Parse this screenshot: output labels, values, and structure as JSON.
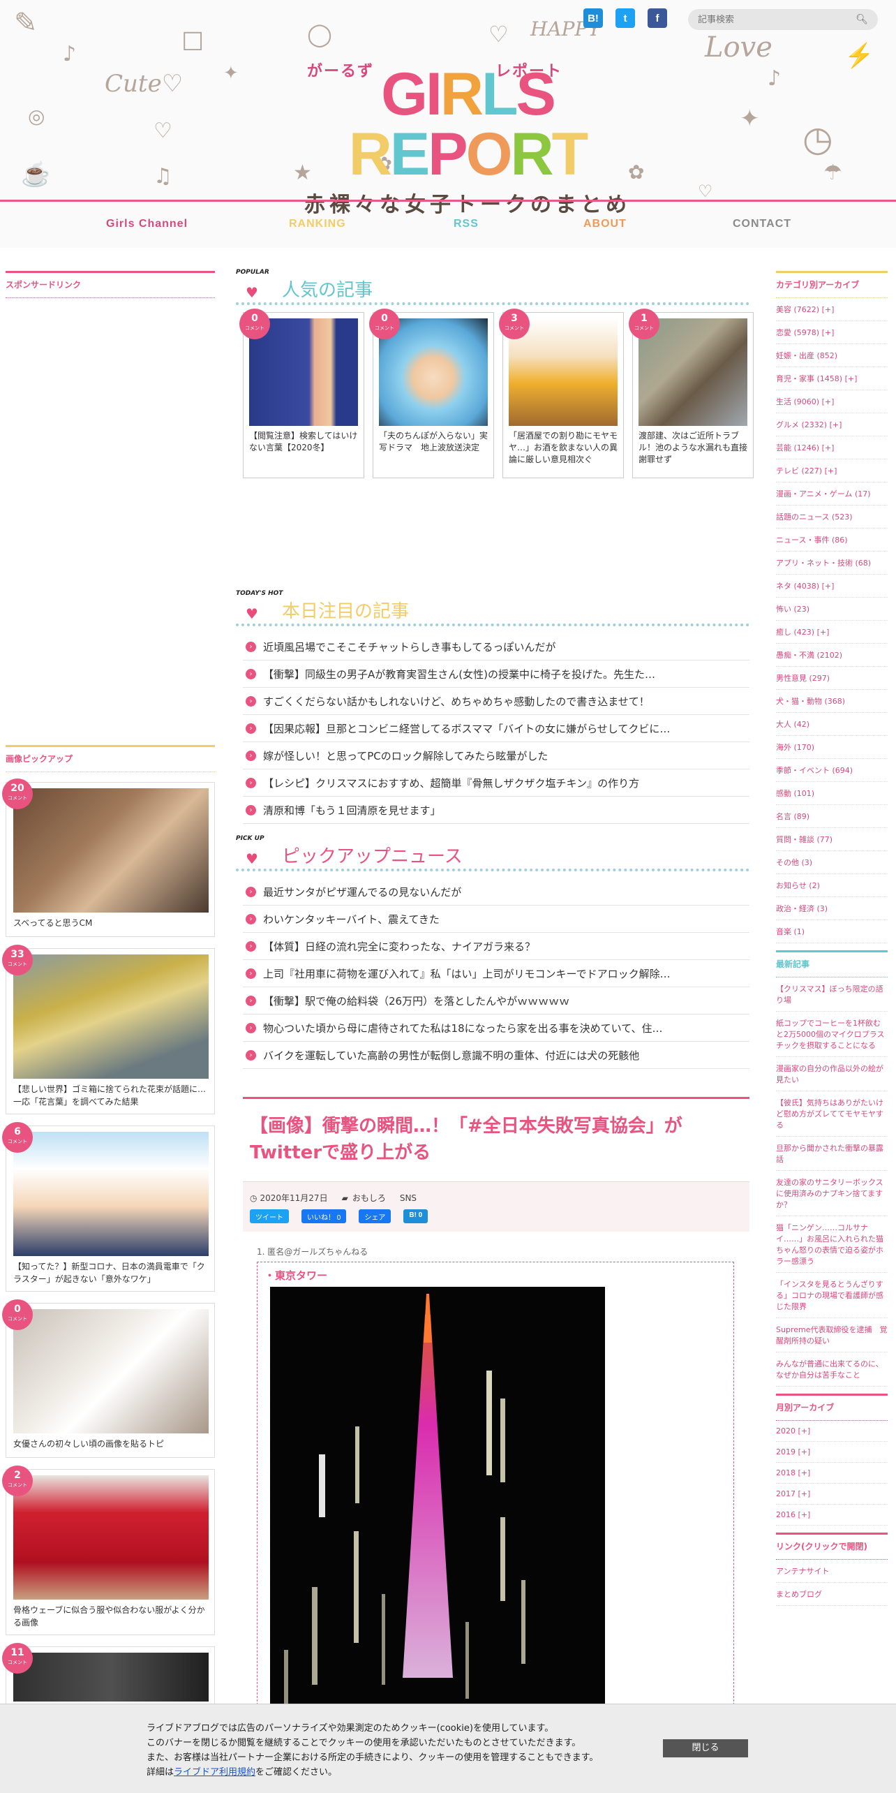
{
  "header": {
    "search_placeholder": "記事検索",
    "logo_main": "GIRLS REPORT",
    "logo_kana_left": "がーるず",
    "logo_kana_right": "レポート",
    "logo_sub": "赤裸々な女子トークのまとめ",
    "social": {
      "hatena": "B!",
      "twitter": "t",
      "facebook": "f"
    }
  },
  "nav": [
    {
      "label": "Girls Channel",
      "color": "#d54a7c"
    },
    {
      "label": "RANKING",
      "color": "#f2cc66"
    },
    {
      "label": "RSS",
      "color": "#62c6ce"
    },
    {
      "label": "ABOUT",
      "color": "#f09a5a"
    },
    {
      "label": "CONTACT",
      "color": "#8a8a8a"
    }
  ],
  "left": {
    "sponsor_title": "スポンサードリンク",
    "pickup_title": "画像ピックアップ",
    "pickups": [
      {
        "count": "20",
        "title": "スベってると思うCM"
      },
      {
        "count": "33",
        "title": "【悲しい世界】ゴミ箱に捨てられた花束が話題に…一応「花言葉」を調べてみた結果"
      },
      {
        "count": "6",
        "title": "【知ってた？】新型コロナ、日本の満員電車で「クラスター」が起きない「意外なワケ」"
      },
      {
        "count": "0",
        "title": "女優さんの初々しい頃の画像を貼るトピ"
      },
      {
        "count": "2",
        "title": "骨格ウェーブに似合う服や似合わない服がよく分かる画像"
      },
      {
        "count": "11",
        "title": ""
      }
    ],
    "count_label": "コメント"
  },
  "main": {
    "popular": {
      "badge": "POPULAR",
      "title": "人気の記事",
      "items": [
        {
          "count": "0",
          "title": "【閲覧注意】検索してはいけない言葉【2020冬】"
        },
        {
          "count": "0",
          "title": "「夫のちんぽが入らない」実写ドラマ　地上波放送決定"
        },
        {
          "count": "3",
          "title": "「居酒屋での割り勘にモヤモヤ…」お酒を飲まない人の異論に厳しい意見相次ぐ"
        },
        {
          "count": "1",
          "title": "渡部建、次はご近所トラブル！池のような水漏れも直接謝罪せず"
        }
      ]
    },
    "todays": {
      "badge": "TODAY'S HOT",
      "title": "本日注目の記事",
      "items": [
        "近頃風呂場でこそこそチャットらしき事もしてるっぽいんだが",
        "【衝撃】同級生の男子Aが教育実習生さん(女性)の授業中に椅子を投げた。先生た…",
        "すごくくだらない話かもしれないけど、めちゃめちゃ感動したので書き込ませて！",
        "【因果応報】旦那とコンビニ経営してるボスママ「バイトの女に嫌がらせしてクビに…",
        "嫁が怪しい！と思ってPCのロック解除してみたら眩暈がした",
        "【レシピ】クリスマスにおすすめ、超簡単『骨無しザクザク塩チキン』の作り方",
        "清原和博「もう１回清原を見せます」"
      ]
    },
    "pickup": {
      "badge": "PICK UP",
      "title": "ピックアップニュース",
      "items": [
        "最近サンタがピザ運んでるの見ないんだが",
        "わいケンタッキーバイト、震えてきた",
        "【体質】日経の流れ完全に変わったな、ナイアガラ来る？",
        "上司『社用車に荷物を運び入れて』私「はい」上司がリモコンキーでドアロック解除…",
        "【衝撃】駅で俺の給料袋（26万円）を落としたんやがｗｗｗｗｗ",
        "物心ついた頃から母に虐待されてた私は18になったら家を出る事を決めていて、住…",
        "バイクを運転していた高齢の男性が転倒し意識不明の重体、付近には犬の死骸他"
      ]
    },
    "article": {
      "title": "【画像】衝撃の瞬間…！「#全日本失敗写真協会」がTwitterで盛り上がる",
      "date": "2020年11月27日",
      "category": "おもしろ",
      "tag": "SNS",
      "buttons": {
        "tweet": "ツイート",
        "like": "いいね！ 0",
        "share": "シェア",
        "hatena": "B! 0"
      },
      "quote_source": "1. 匿名@ガールズちゃんねる",
      "quote_text": "・東京タワー"
    }
  },
  "right": {
    "category_title": "カテゴリ別アーカイブ",
    "categories": [
      "美容 (7622) [+]",
      "恋愛 (5978) [+]",
      "妊娠・出産 (852)",
      "育児・家事 (1458) [+]",
      "生活 (9060) [+]",
      "グルメ (2332) [+]",
      "芸能 (1246) [+]",
      "テレビ (227) [+]",
      "漫画・アニメ・ゲーム (17)",
      "話題のニュース (523)",
      "ニュース・事件 (86)",
      "アプリ・ネット・技術 (68)",
      "ネタ (4038) [+]",
      "怖い (23)",
      "癒し (423) [+]",
      "愚痴・不満 (2102)",
      "男性意見 (297)",
      "犬・猫・動物 (368)",
      "大人 (42)",
      "海外 (170)",
      "季節・イベント (694)",
      "感動 (101)",
      "名言 (89)",
      "質問・雑談 (77)",
      "その他 (3)",
      "お知らせ (2)",
      "政治・経済 (3)",
      "音楽 (1)"
    ],
    "latest_title": "最新記事",
    "latest": [
      "【クリスマス】ぼっち限定の語り場",
      "紙コップでコーヒーを1杯飲むと2万5000個のマイクロプラスチックを摂取することになる",
      "漫画家の自分の作品以外の絵が見たい",
      "【彼氏】気持ちはありがたいけど慰め方がズレててモヤモヤする",
      "旦那から聞かされた衝撃の暴露話",
      "友達の家のサニタリーボックスに使用済みのナプキン捨てますか？",
      "猫「ニンゲン……コルサナイ……」お風呂に入れられた猫ちゃん怒りの表情で迫る姿がホラー感漂う",
      "「インスタを見るとうんざりする」コロナの現場で看護師が感じた限界",
      "Supreme代表取締役を逮捕　覚醒剤所持の疑い",
      "みんなが普通に出来てるのに、なぜか自分は苦手なこと"
    ],
    "monthly_title": "月別アーカイブ",
    "monthly": [
      "2020 [+]",
      "2019 [+]",
      "2018 [+]",
      "2017 [+]",
      "2016 [+]"
    ],
    "links_title": "リンク(クリックで開閉)",
    "links": [
      "アンテナサイト",
      "まとめブログ"
    ]
  },
  "cookie": {
    "line1": "ライブドアブログでは広告のパーソナライズや効果測定のためクッキー(cookie)を使用しています。",
    "line2": "このバナーを閉じるか閲覧を継続することでクッキーの使用を承認いただいたものとさせていただきます。",
    "line3": "また、お客様は当社パートナー企業における所定の手続きにより、クッキーの使用を管理することもできます。",
    "line4_pre": "詳細は",
    "line4_link": "ライブドア利用規約",
    "line4_post": "をご確認ください。",
    "close": "閉じる"
  },
  "colors": {
    "accent_pink": "#e9537f",
    "teal": "#62c6ce",
    "yellow": "#f2cc66",
    "orange": "#f09a5a",
    "green": "#8dc63f"
  }
}
